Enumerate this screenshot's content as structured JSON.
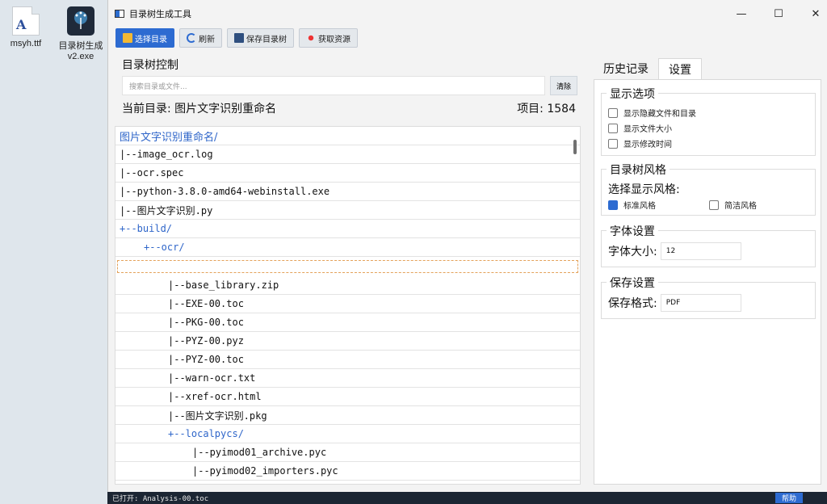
{
  "desktop": {
    "icons": [
      {
        "label": "msyh.ttf"
      },
      {
        "label_line1": "目录树生成",
        "label_line2": "v2.exe"
      }
    ]
  },
  "window": {
    "title": "目录树生成工具",
    "controls": {
      "minimize": "—",
      "maximize": "☐",
      "close": "✕"
    }
  },
  "toolbar": {
    "select_dir": "选择目录",
    "refresh": "刷新",
    "save_tree": "保存目录树",
    "get_resources": "获取资源"
  },
  "tree_control": {
    "title": "目录树控制",
    "search_placeholder": "搜索目录或文件...",
    "clear_label": "清除",
    "current_dir_label": "当前目录:",
    "current_dir": "图片文字识别重命名",
    "items_label": "项目:",
    "items_count": "1584"
  },
  "tree": {
    "rows": [
      {
        "text": "图片文字识别重命名/",
        "type": "root",
        "indent": 0
      },
      {
        "text": "|--image_ocr.log",
        "type": "file",
        "indent": 0
      },
      {
        "text": "|--ocr.spec",
        "type": "file",
        "indent": 0
      },
      {
        "text": "|--python-3.8.0-amd64-webinstall.exe",
        "type": "file",
        "indent": 0
      },
      {
        "text": "|--图片文字识别.py",
        "type": "file",
        "indent": 0
      },
      {
        "text": "+--build/",
        "type": "dir",
        "indent": 0
      },
      {
        "text": "+--ocr/",
        "type": "dir",
        "indent": 1
      },
      {
        "text": "",
        "type": "sel",
        "indent": 0
      },
      {
        "text": "|--base_library.zip",
        "type": "file",
        "indent": 2
      },
      {
        "text": "|--EXE-00.toc",
        "type": "file",
        "indent": 2
      },
      {
        "text": "|--PKG-00.toc",
        "type": "file",
        "indent": 2
      },
      {
        "text": "|--PYZ-00.pyz",
        "type": "file",
        "indent": 2
      },
      {
        "text": "|--PYZ-00.toc",
        "type": "file",
        "indent": 2
      },
      {
        "text": "|--warn-ocr.txt",
        "type": "file",
        "indent": 2
      },
      {
        "text": "|--xref-ocr.html",
        "type": "file",
        "indent": 2
      },
      {
        "text": "|--图片文字识别.pkg",
        "type": "file",
        "indent": 2
      },
      {
        "text": "+--localpycs/",
        "type": "dir",
        "indent": 2
      },
      {
        "text": "|--pyimod01_archive.pyc",
        "type": "file",
        "indent": 3
      },
      {
        "text": "|--pyimod02_importers.pyc",
        "type": "file",
        "indent": 3
      }
    ]
  },
  "tabs": [
    {
      "label": "历史记录",
      "active": false
    },
    {
      "label": "设置",
      "active": true
    }
  ],
  "settings": {
    "display_options": {
      "title": "显示选项",
      "options": [
        {
          "label": "显示隐藏文件和目录",
          "checked": false
        },
        {
          "label": "显示文件大小",
          "checked": false
        },
        {
          "label": "显示修改时间",
          "checked": false
        }
      ]
    },
    "tree_style": {
      "title": "目录树风格",
      "prompt": "选择显示风格:",
      "standard": "标准风格",
      "simple": "简洁风格",
      "standard_checked": true,
      "simple_checked": false
    },
    "font": {
      "title": "字体设置",
      "size_label": "字体大小:",
      "size_value": "12"
    },
    "save": {
      "title": "保存设置",
      "format_label": "保存格式:",
      "format_value": "PDF"
    }
  },
  "statusbar": {
    "text": "已打开: Analysis-00.toc",
    "help": "帮助"
  },
  "colors": {
    "accent": "#2d6bd1",
    "dir_text": "#2e65c9",
    "statusbar_bg": "#1c2633"
  }
}
